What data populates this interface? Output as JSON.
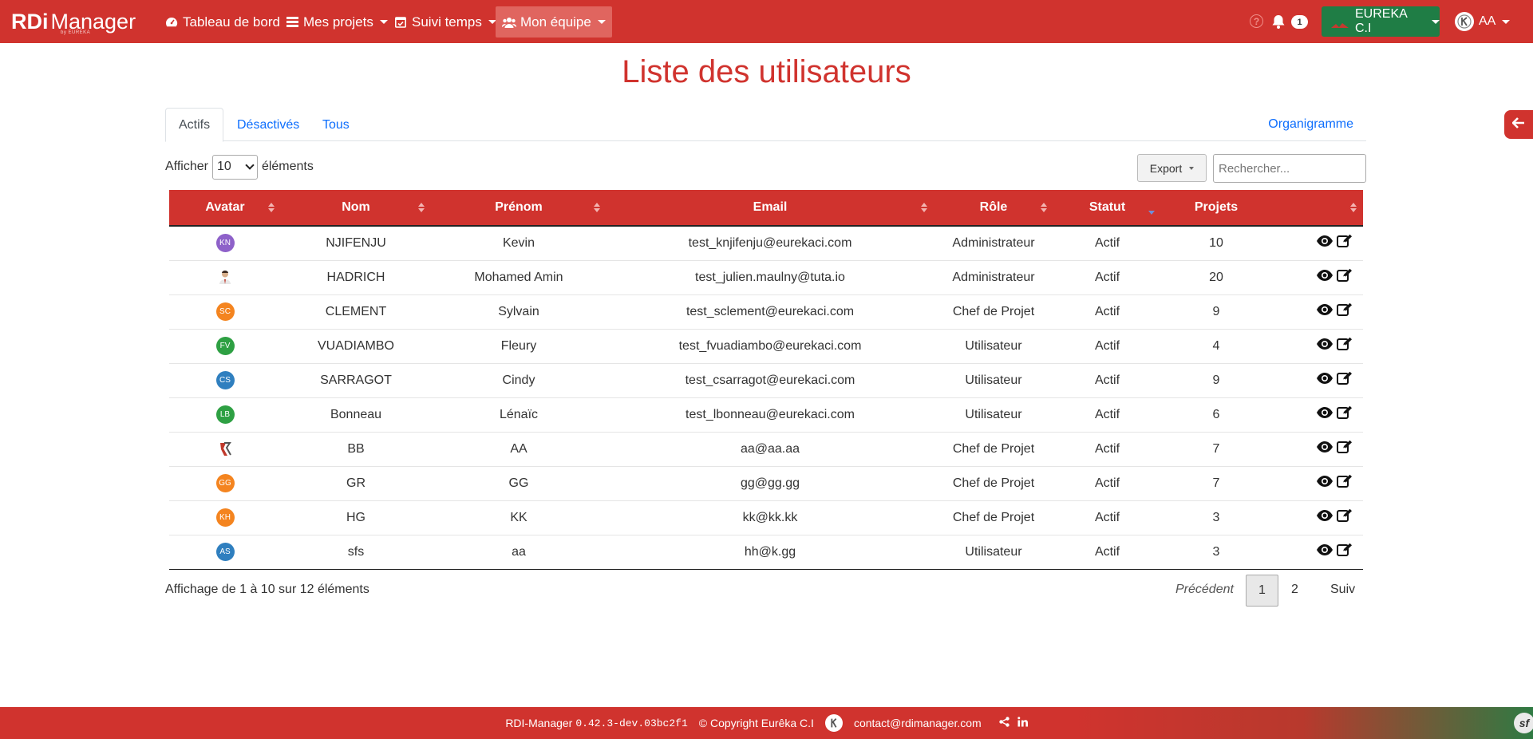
{
  "brand": {
    "rdi": "RDi",
    "manager": "Manager",
    "tagline": "by EUREKA"
  },
  "nav": {
    "items": [
      {
        "label": "Tableau de bord",
        "icon": "dashboard-icon"
      },
      {
        "label": "Mes projets",
        "icon": "list-icon"
      },
      {
        "label": "Suivi temps",
        "icon": "calendar-check-icon"
      },
      {
        "label": "Mon équipe",
        "icon": "users-icon"
      }
    ],
    "help_symbol": "?",
    "notification_count": "1",
    "organization": "EUREKA C.I",
    "user": "AA"
  },
  "page": {
    "title": "Liste des utilisateurs"
  },
  "tabs": {
    "active": "Actifs",
    "disabled": "Désactivés",
    "all": "Tous",
    "organigramme": "Organigramme"
  },
  "controls": {
    "show_label": "Afficher",
    "page_length": "10",
    "elements_label": "éléments",
    "export_label": "Export",
    "search_placeholder": "Rechercher..."
  },
  "table": {
    "columns": [
      "Avatar",
      "Nom",
      "Prénom",
      "Email",
      "Rôle",
      "Statut",
      "Projets",
      ""
    ],
    "rows": [
      {
        "avatar": "KN",
        "avatar_color": "#8e61c9",
        "nom": "NJIFENJU",
        "prenom": "Kevin",
        "email": "test_knjifenju@eurekaci.com",
        "role": "Administrateur",
        "statut": "Actif",
        "projets": "10"
      },
      {
        "avatar": "",
        "avatar_type": "photo",
        "nom": "HADRICH",
        "prenom": "Mohamed Amin",
        "email": "test_julien.maulny@tuta.io",
        "role": "Administrateur",
        "statut": "Actif",
        "projets": "20"
      },
      {
        "avatar": "SC",
        "avatar_color": "#f4841f",
        "nom": "CLEMENT",
        "prenom": "Sylvain",
        "email": "test_sclement@eurekaci.com",
        "role": "Chef de Projet",
        "statut": "Actif",
        "projets": "9"
      },
      {
        "avatar": "FV",
        "avatar_color": "#2ea043",
        "nom": "VUADIAMBO",
        "prenom": "Fleury",
        "email": "test_fvuadiambo@eurekaci.com",
        "role": "Utilisateur",
        "statut": "Actif",
        "projets": "4"
      },
      {
        "avatar": "CS",
        "avatar_color": "#2f7fbf",
        "nom": "SARRAGOT",
        "prenom": "Cindy",
        "email": "test_csarragot@eurekaci.com",
        "role": "Utilisateur",
        "statut": "Actif",
        "projets": "9"
      },
      {
        "avatar": "LB",
        "avatar_color": "#2ea043",
        "nom": "Bonneau",
        "prenom": "Lénaïc",
        "email": "test_lbonneau@eurekaci.com",
        "role": "Utilisateur",
        "statut": "Actif",
        "projets": "6"
      },
      {
        "avatar": "",
        "avatar_type": "logo",
        "nom": "BB",
        "prenom": "AA",
        "email": "aa@aa.aa",
        "role": "Chef de Projet",
        "statut": "Actif",
        "projets": "7"
      },
      {
        "avatar": "GG",
        "avatar_color": "#f4841f",
        "nom": "GR",
        "prenom": "GG",
        "email": "gg@gg.gg",
        "role": "Chef de Projet",
        "statut": "Actif",
        "projets": "7"
      },
      {
        "avatar": "KH",
        "avatar_color": "#f4841f",
        "nom": "HG",
        "prenom": "KK",
        "email": "kk@kk.kk",
        "role": "Chef de Projet",
        "statut": "Actif",
        "projets": "3"
      },
      {
        "avatar": "AS",
        "avatar_color": "#2f7fbf",
        "nom": "sfs",
        "prenom": "aa",
        "email": "hh@k.gg",
        "role": "Utilisateur",
        "statut": "Actif",
        "projets": "3"
      }
    ]
  },
  "info": "Affichage de 1 à 10 sur 12 éléments",
  "pagination": {
    "previous": "Précédent",
    "page1": "1",
    "page2": "2",
    "next": "Suiv"
  },
  "footer": {
    "app": "RDI-Manager",
    "version": "0.42.3-dev.03bc2f1",
    "copyright": "© Copyright Eurêka C.I",
    "email": "contact@rdimanager.com"
  },
  "colors": {
    "primary": "#d0332e",
    "org_green": "#1f7d45",
    "link": "#0d6efd"
  }
}
